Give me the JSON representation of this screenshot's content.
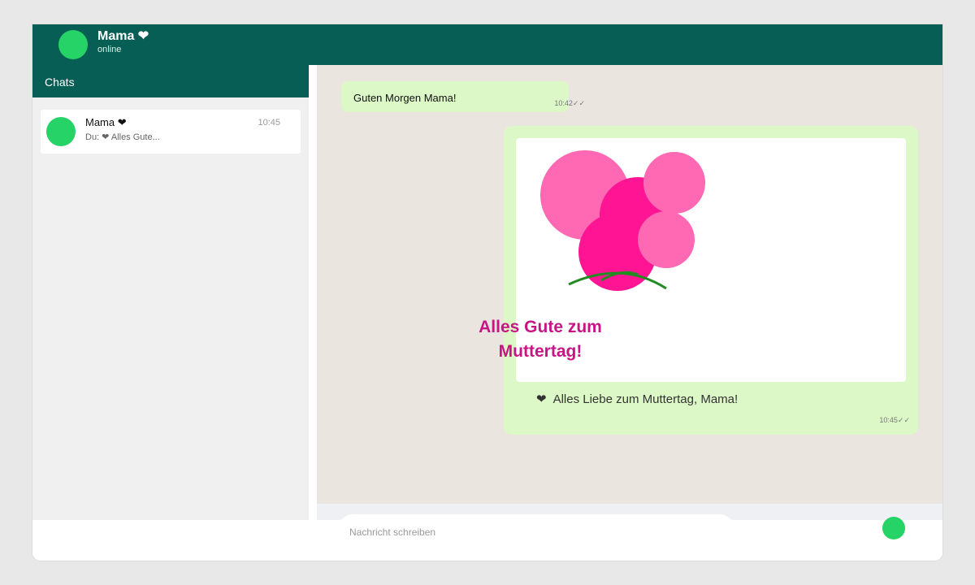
{
  "header": {
    "contact_name": "Mama ❤",
    "status": "online"
  },
  "sidebar": {
    "title": "Chats",
    "chats": [
      {
        "name": "Mama ❤",
        "time": "10:45",
        "preview": "Du: ❤  Alles Gute..."
      }
    ]
  },
  "messages": [
    {
      "text": "Guten Morgen Mama!",
      "time": "10:42",
      "ticks": "✓✓"
    },
    {
      "card_title": "Alles Gute zum Muttertag!",
      "caption_icon": "❤",
      "caption": "Alles Liebe zum Muttertag, Mama!",
      "time": "10:45",
      "ticks": "✓✓"
    }
  ],
  "composer": {
    "placeholder": "Nachricht schreiben"
  },
  "colors": {
    "brand": "#075e54",
    "accent": "#25d366",
    "bubble": "#dcf8c6",
    "flower_light": "#ff69b4",
    "flower_dark": "#ff1493",
    "stem": "#228b22",
    "card_text": "#c71585"
  }
}
